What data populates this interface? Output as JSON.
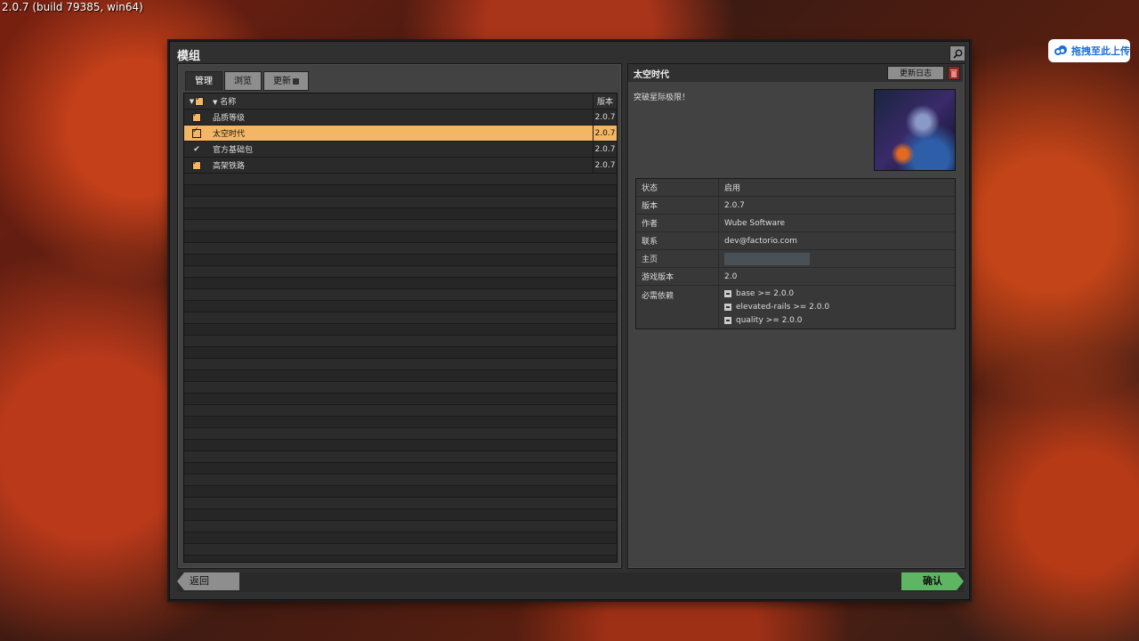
{
  "build_info": "2.0.7 (build 79385, win64)",
  "upload_chip": {
    "label": "拖拽至此上传",
    "icon": "cloud-icon",
    "color": "#1a6fd8"
  },
  "window": {
    "title": "模组"
  },
  "tabs": [
    {
      "label": "管理",
      "active": true
    },
    {
      "label": "浏览",
      "active": false
    },
    {
      "label": "更新",
      "active": false
    }
  ],
  "list": {
    "headers": {
      "name": "名称",
      "version": "版本"
    },
    "rows": [
      {
        "name": "品质等级",
        "version": "2.0.7",
        "enabled": true,
        "selected": false
      },
      {
        "name": "太空时代",
        "version": "2.0.7",
        "enabled": true,
        "selected": true
      },
      {
        "name": "官方基础包",
        "version": "2.0.7",
        "enabled": true,
        "selected": false,
        "locked": true
      },
      {
        "name": "高架铁路",
        "version": "2.0.7",
        "enabled": true,
        "selected": false
      }
    ]
  },
  "details": {
    "title": "太空时代",
    "changelog_label": "更新日志",
    "description": "突破星际极限！",
    "properties": {
      "status_key": "状态",
      "status_val": "启用",
      "version_key": "版本",
      "version_val": "2.0.7",
      "author_key": "作者",
      "author_val": "Wube Software",
      "contact_key": "联系",
      "contact_val": "dev@factorio.com",
      "homepage_key": "主页",
      "game_version_key": "游戏版本",
      "game_version_val": "2.0",
      "deps_key": "必需依赖"
    },
    "dependencies": [
      "base >= 2.0.0",
      "elevated-rails >= 2.0.0",
      "quality >= 2.0.0"
    ]
  },
  "footer": {
    "back_label": "返回",
    "confirm_label": "确认"
  },
  "colors": {
    "accent": "#f2b664",
    "confirm": "#5eb663",
    "danger": "#8b2a22"
  }
}
